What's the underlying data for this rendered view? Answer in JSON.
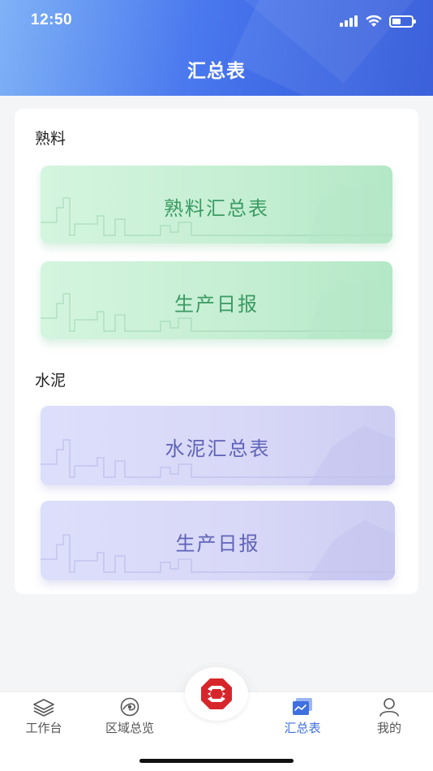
{
  "status_bar": {
    "time": "12:50"
  },
  "header": {
    "title": "汇总表"
  },
  "sections": [
    {
      "title": "熟料",
      "tiles": [
        {
          "label": "熟料汇总表"
        },
        {
          "label": "生产日报"
        }
      ]
    },
    {
      "title": "水泥",
      "tiles": [
        {
          "label": "水泥汇总表"
        },
        {
          "label": "生产日报"
        }
      ]
    }
  ],
  "tabbar": {
    "items": [
      {
        "label": "工作台",
        "icon": "layers-icon"
      },
      {
        "label": "区域总览",
        "icon": "region-icon"
      },
      {
        "label": "汇总表",
        "icon": "chart-icon",
        "active": true
      },
      {
        "label": "我的",
        "icon": "user-icon"
      }
    ],
    "center_icon": "octagon-logo-icon"
  },
  "colors": {
    "header_start": "#7fb2f6",
    "header_end": "#2d55d8",
    "green_tile_text": "#3b9a63",
    "purple_tile_text": "#5f63b8",
    "active_tab": "#3f6fe0",
    "logo_red": "#d7262b"
  }
}
